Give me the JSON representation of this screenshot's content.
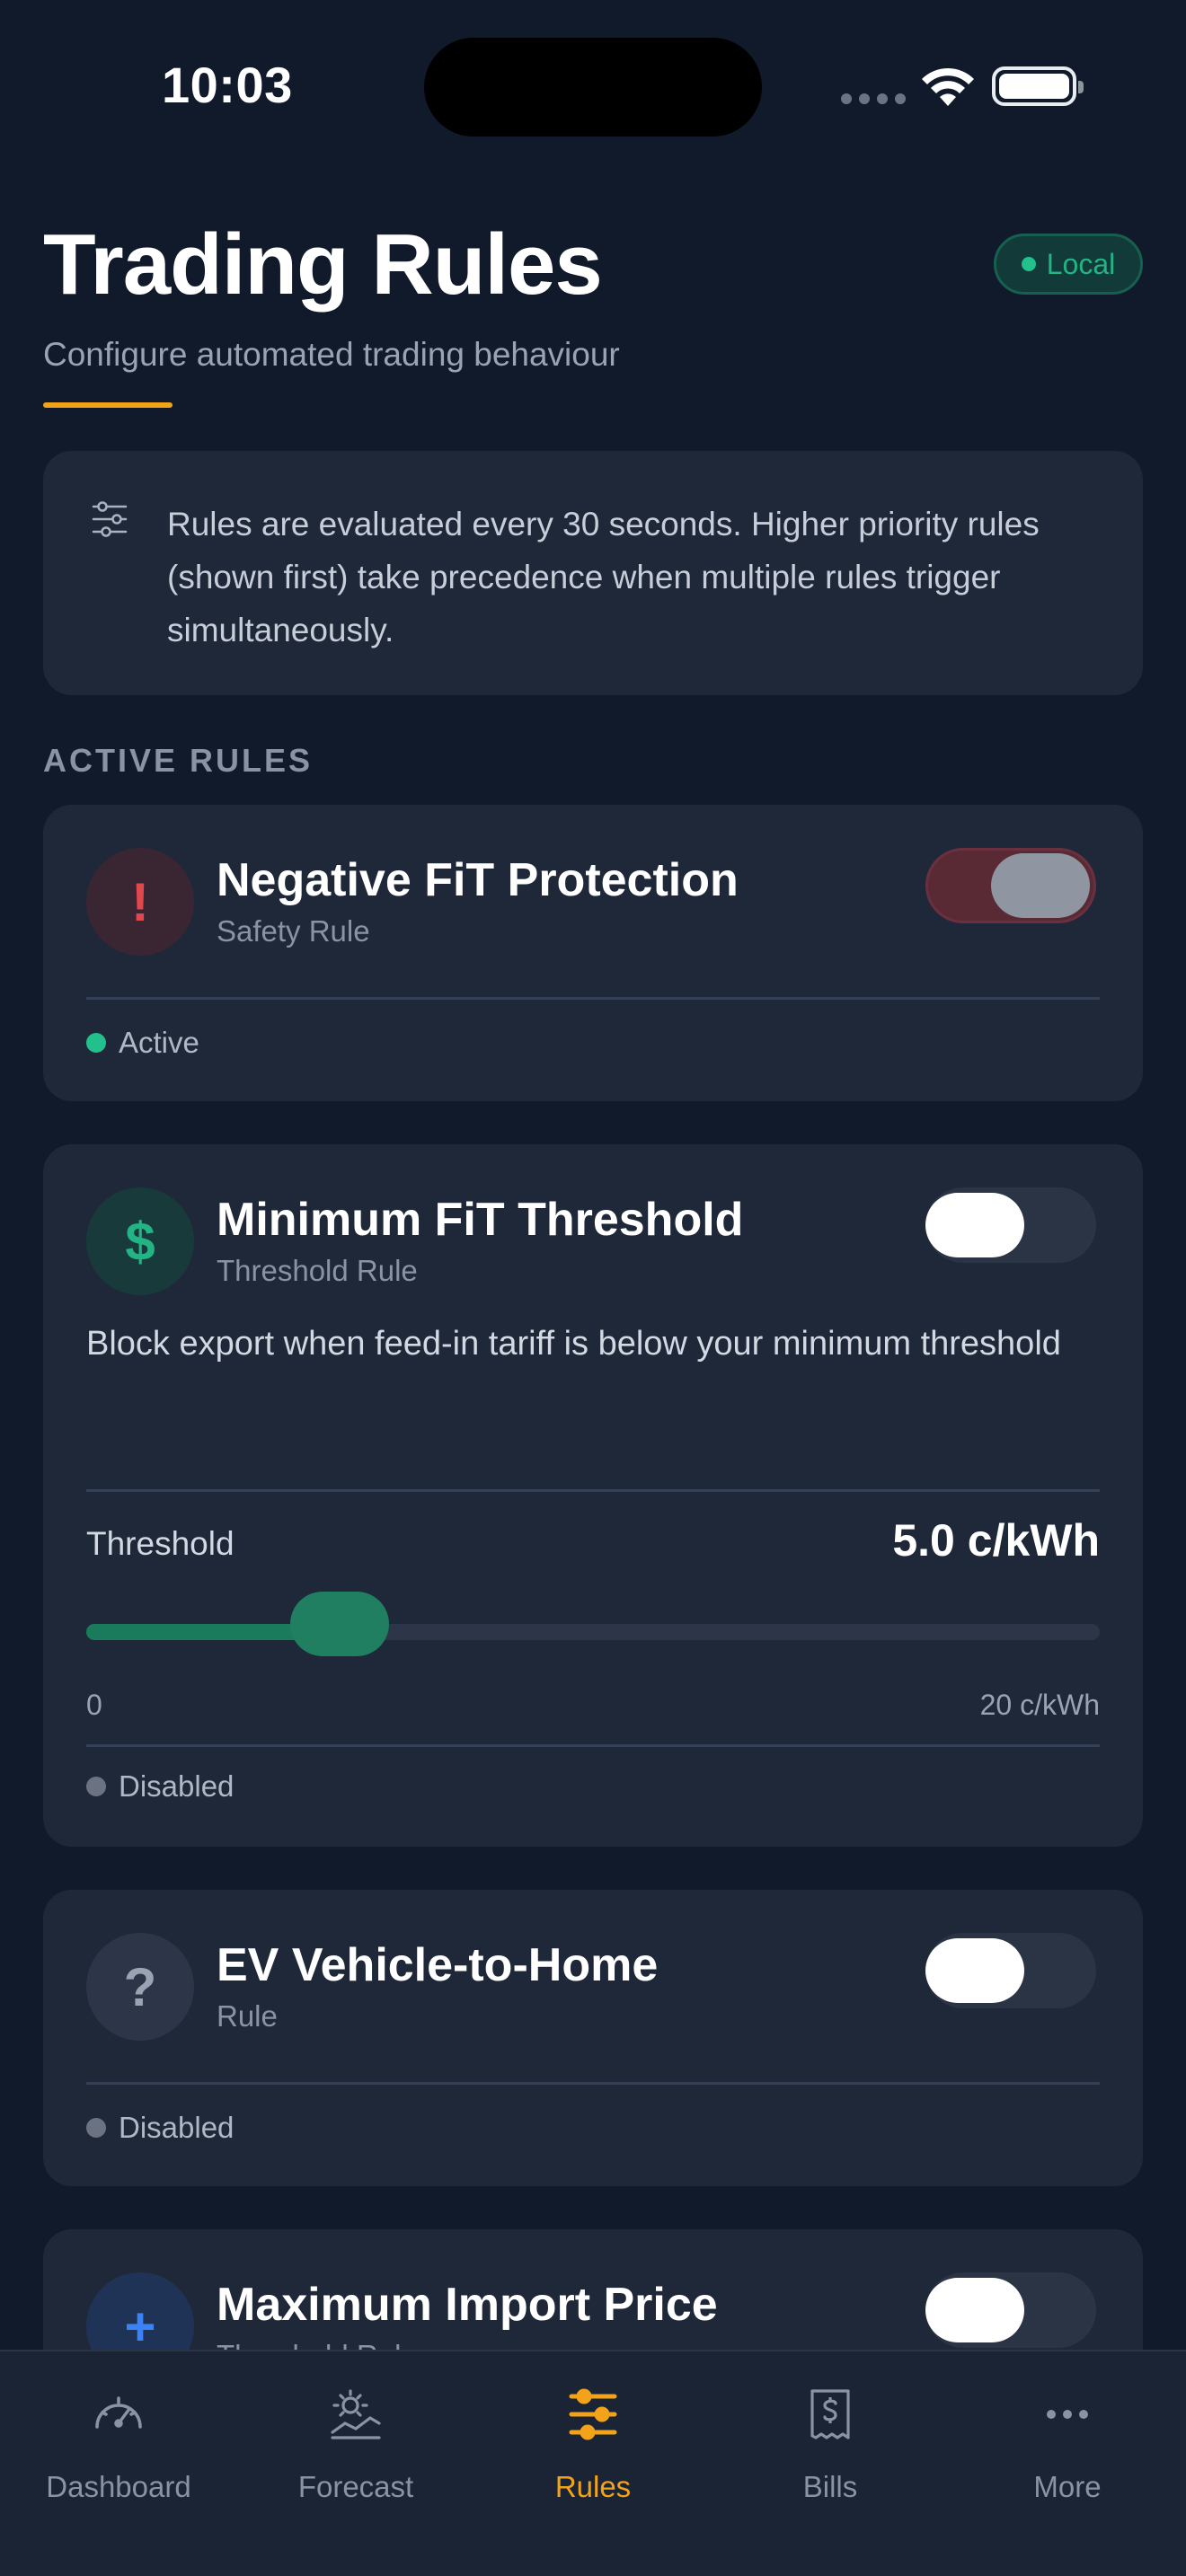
{
  "status_bar": {
    "time": "10:03"
  },
  "header": {
    "title": "Trading Rules",
    "subtitle": "Configure automated trading behaviour",
    "badge": "Local"
  },
  "info": {
    "text": "Rules are evaluated every 30 seconds. Higher priority rules (shown first) take precedence when multiple rules trigger simultaneously."
  },
  "section": {
    "label": "ACTIVE RULES"
  },
  "rules": [
    {
      "name": "Negative FiT Protection",
      "type": "Safety Rule",
      "icon_glyph": "!",
      "icon": "alert-icon",
      "enabled": true,
      "status": "Active",
      "status_color": "#22c08a"
    },
    {
      "name": "Minimum FiT Threshold",
      "type": "Threshold Rule",
      "icon_glyph": "$",
      "icon": "dollar-icon",
      "enabled": false,
      "description": "Block export when feed-in tariff is below your minimum threshold",
      "threshold_label": "Threshold",
      "threshold_value": "5.0 c/kWh",
      "slider_min_label": "0",
      "slider_max_label": "20 c/kWh",
      "slider_fraction": 0.25,
      "status": "Disabled",
      "status_color": "#6b7382"
    },
    {
      "name": "EV Vehicle-to-Home",
      "type": "Rule",
      "icon_glyph": "?",
      "icon": "question-icon",
      "enabled": false,
      "status": "Disabled",
      "status_color": "#6b7382"
    },
    {
      "name": "Maximum Import Price",
      "type": "Threshold Rule",
      "icon_glyph": "+",
      "icon": "plus-icon",
      "enabled": false
    }
  ],
  "nav": {
    "items": [
      {
        "label": "Dashboard",
        "icon": "gauge-icon"
      },
      {
        "label": "Forecast",
        "icon": "sun-forecast-icon"
      },
      {
        "label": "Rules",
        "icon": "sliders-icon",
        "active": true
      },
      {
        "label": "Bills",
        "icon": "receipt-icon"
      },
      {
        "label": "More",
        "icon": "more-dots-icon"
      }
    ]
  },
  "colors": {
    "background": "#111a2b",
    "card": "#1e2839",
    "accent": "#f2a31a",
    "success": "#22c08a",
    "danger": "#e0484e"
  }
}
